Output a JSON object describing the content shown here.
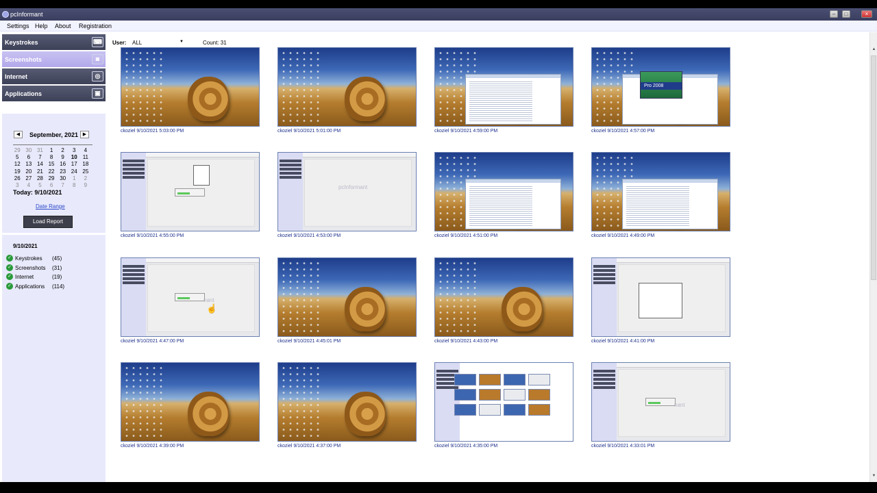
{
  "window": {
    "title": "pcInformant",
    "min": "–",
    "max": "□",
    "close": "×"
  },
  "menu": [
    "Settings",
    "Help",
    "About",
    "Registration"
  ],
  "nav": [
    {
      "label": "Keystrokes",
      "icon": "keyboard-icon",
      "glyph": "⌨",
      "active": false
    },
    {
      "label": "Screenshots",
      "icon": "camera-icon",
      "glyph": "◙",
      "active": true
    },
    {
      "label": "Internet",
      "icon": "globe-icon",
      "glyph": "◎",
      "active": false
    },
    {
      "label": "Applications",
      "icon": "window-icon",
      "glyph": "▣",
      "active": false
    }
  ],
  "calendar": {
    "month": "September, 2021",
    "prev": "◀",
    "next": "▶",
    "weeks": [
      [
        [
          "29",
          1
        ],
        [
          "30",
          1
        ],
        [
          "31",
          1
        ],
        [
          "1",
          0
        ],
        [
          "2",
          0
        ],
        [
          "3",
          0
        ],
        [
          "4",
          0
        ]
      ],
      [
        [
          "5",
          0
        ],
        [
          "6",
          0
        ],
        [
          "7",
          0
        ],
        [
          "8",
          0
        ],
        [
          "9",
          0
        ],
        [
          "10",
          2
        ],
        [
          "11",
          0
        ]
      ],
      [
        [
          "12",
          0
        ],
        [
          "13",
          0
        ],
        [
          "14",
          0
        ],
        [
          "15",
          0
        ],
        [
          "16",
          0
        ],
        [
          "17",
          0
        ],
        [
          "18",
          0
        ]
      ],
      [
        [
          "19",
          0
        ],
        [
          "20",
          0
        ],
        [
          "21",
          0
        ],
        [
          "22",
          0
        ],
        [
          "23",
          0
        ],
        [
          "24",
          0
        ],
        [
          "25",
          0
        ]
      ],
      [
        [
          "26",
          0
        ],
        [
          "27",
          0
        ],
        [
          "28",
          0
        ],
        [
          "29",
          0
        ],
        [
          "30",
          0
        ],
        [
          "1",
          1
        ],
        [
          "2",
          1
        ]
      ],
      [
        [
          "3",
          1
        ],
        [
          "4",
          1
        ],
        [
          "5",
          1
        ],
        [
          "6",
          1
        ],
        [
          "7",
          1
        ],
        [
          "8",
          1
        ],
        [
          "9",
          1
        ]
      ]
    ],
    "today": "Today: 9/10/2021",
    "date_range": "Date Range",
    "load_report": "Load Report"
  },
  "summary": {
    "date": "9/10/2021",
    "items": [
      {
        "name": "Keystrokes",
        "count": "(45)"
      },
      {
        "name": "Screenshots",
        "count": "(31)"
      },
      {
        "name": "Internet",
        "count": "(19)"
      },
      {
        "name": "Applications",
        "count": "(114)"
      }
    ]
  },
  "filter": {
    "user_label": "User:",
    "user_value": "ALL",
    "count": "Count: 31"
  },
  "screenshots": [
    {
      "kind": "desktop",
      "caption": "ckoziel  9/10/2021 5:03:00 PM"
    },
    {
      "kind": "desktop",
      "caption": "ckoziel  9/10/2021 5:01:00 PM"
    },
    {
      "kind": "explorer",
      "caption": "ckoziel  9/10/2021 4:59:00 PM"
    },
    {
      "kind": "splash",
      "caption": "ckoziel  9/10/2021 4:57:00 PM",
      "splash_text": "Pro 2008"
    },
    {
      "kind": "app-dialog",
      "caption": "ckoziel  9/10/2021 4:55:00 PM"
    },
    {
      "kind": "app-logo",
      "caption": "ckoziel  9/10/2021 4:53:00 PM",
      "logo_text": "pcInformant"
    },
    {
      "kind": "explorer",
      "caption": "ckoziel  9/10/2021 4:51:00 PM"
    },
    {
      "kind": "explorer",
      "caption": "ckoziel  9/10/2021 4:49:00 PM"
    },
    {
      "kind": "app-progress",
      "caption": "ckoziel  9/10/2021 4:47:00 PM",
      "logo_text": "nant",
      "cursor": true
    },
    {
      "kind": "desktop",
      "caption": "ckoziel  9/10/2021 4:45:01 PM"
    },
    {
      "kind": "desktop",
      "caption": "ckoziel  9/10/2021 4:43:00 PM"
    },
    {
      "kind": "app-list",
      "caption": "ckoziel  9/10/2021 4:41:00 PM"
    },
    {
      "kind": "desktop",
      "caption": "ckoziel  9/10/2021 4:39:00 PM"
    },
    {
      "kind": "desktop",
      "caption": "ckoziel  9/10/2021 4:37:00 PM"
    },
    {
      "kind": "gallery",
      "caption": "ckoziel  9/10/2021 4:35:00 PM"
    },
    {
      "kind": "app-progress",
      "caption": "ckoziel  9/10/2021 4:33:01 PM",
      "logo_text": "nant"
    }
  ]
}
